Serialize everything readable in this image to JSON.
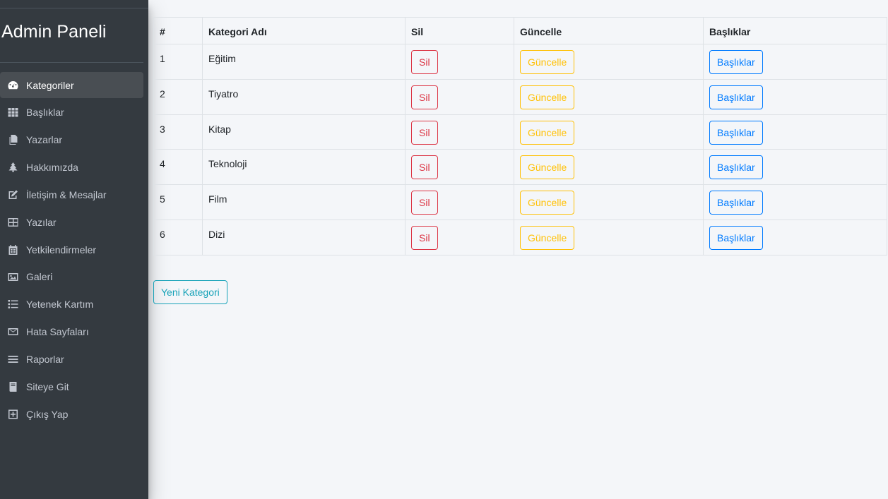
{
  "sidebar": {
    "brand": "Admin Paneli",
    "items": [
      {
        "label": "Kategoriler",
        "icon": "dashboard-icon",
        "active": true
      },
      {
        "label": "Başlıklar",
        "icon": "grid-icon"
      },
      {
        "label": "Yazarlar",
        "icon": "copy-icon"
      },
      {
        "label": "Hakkımızda",
        "icon": "tree-icon"
      },
      {
        "label": "İletişim & Mesajlar",
        "icon": "edit-icon"
      },
      {
        "label": "Yazılar",
        "icon": "table-icon"
      },
      {
        "label": "Yetkilendirmeler",
        "icon": "calendar-icon"
      },
      {
        "label": "Galeri",
        "icon": "image-icon"
      },
      {
        "label": "Yetenek Kartım",
        "icon": "list-icon"
      },
      {
        "label": "Hata Sayfaları",
        "icon": "envelope-icon"
      },
      {
        "label": "Raporlar",
        "icon": "bars-icon"
      },
      {
        "label": "Siteye Git",
        "icon": "book-icon"
      },
      {
        "label": "Çıkış Yap",
        "icon": "plus-square-icon"
      }
    ]
  },
  "table": {
    "headers": [
      "#",
      "Kategori Adı",
      "Sil",
      "Güncelle",
      "Başlıklar"
    ],
    "rows": [
      {
        "id": "1",
        "name": "Eğitim",
        "delete": "Sil",
        "update": "Güncelle",
        "titles": "Başlıklar"
      },
      {
        "id": "2",
        "name": "Tiyatro",
        "delete": "Sil",
        "update": "Güncelle",
        "titles": "Başlıklar"
      },
      {
        "id": "3",
        "name": "Kitap",
        "delete": "Sil",
        "update": "Güncelle",
        "titles": "Başlıklar"
      },
      {
        "id": "4",
        "name": "Teknoloji",
        "delete": "Sil",
        "update": "Güncelle",
        "titles": "Başlıklar"
      },
      {
        "id": "5",
        "name": "Film",
        "delete": "Sil",
        "update": "Güncelle",
        "titles": "Başlıklar"
      },
      {
        "id": "6",
        "name": "Dizi",
        "delete": "Sil",
        "update": "Güncelle",
        "titles": "Başlıklar"
      }
    ]
  },
  "actions": {
    "new_category": "Yeni Kategori"
  },
  "colors": {
    "sidebar_bg": "#343a40",
    "danger": "#dc3545",
    "warning": "#ffc107",
    "primary": "#007bff",
    "info": "#17a2b8"
  }
}
